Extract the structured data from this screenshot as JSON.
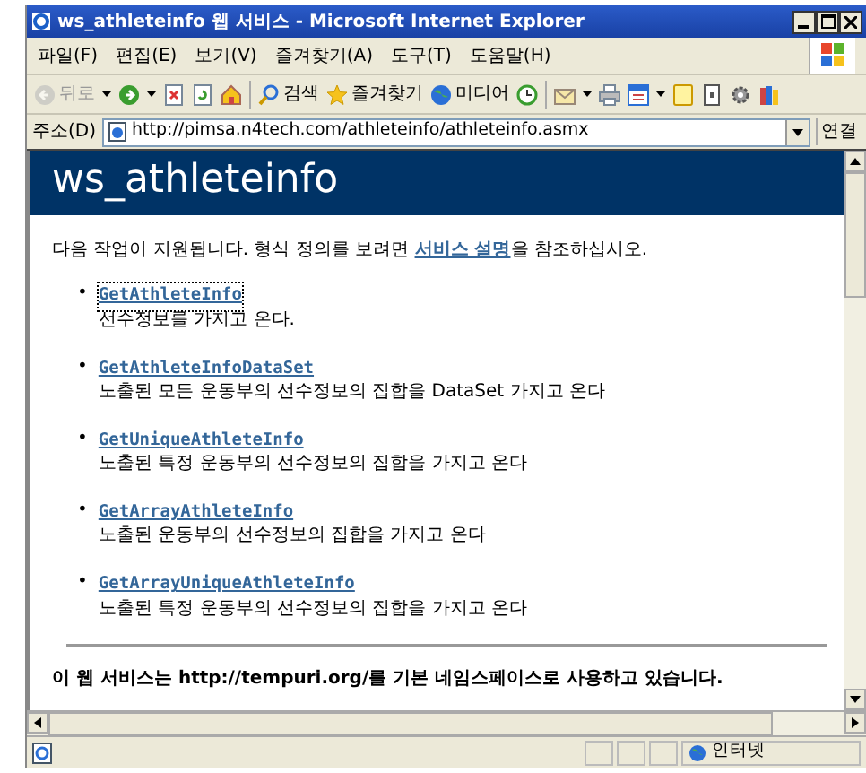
{
  "window": {
    "title": "ws_athleteinfo 웹 서비스 - Microsoft Internet Explorer"
  },
  "menu": [
    "파일(F)",
    "편집(E)",
    "보기(V)",
    "즐겨찾기(A)",
    "도구(T)",
    "도움말(H)"
  ],
  "toolbar": [
    {
      "kind": "back",
      "label": "뒤로",
      "disabled": true
    },
    {
      "kind": "forward"
    },
    {
      "kind": "stop"
    },
    {
      "kind": "refresh"
    },
    {
      "kind": "home"
    },
    {
      "kind": "search",
      "label": "검색"
    },
    {
      "kind": "favorites",
      "label": "즐겨찾기"
    },
    {
      "kind": "media",
      "label": "미디어"
    },
    {
      "kind": "history"
    },
    {
      "kind": "mail"
    },
    {
      "kind": "print"
    },
    {
      "kind": "edit"
    },
    {
      "kind": "note"
    },
    {
      "kind": "messenger"
    },
    {
      "kind": "tool"
    },
    {
      "kind": "research"
    }
  ],
  "address": {
    "label": "주소(D)",
    "url": "http://pimsa.n4tech.com/athleteinfo/athleteinfo.asmx",
    "go": "연결"
  },
  "page": {
    "heading": "ws_athleteinfo",
    "intro": {
      "before": "다음 작업이 지원됩니다. 형식 정의를 보려면 ",
      "link": "서비스 설명",
      "after": "을 참조하십시오."
    },
    "operations": [
      {
        "marker": "•",
        "name": "GetAthleteInfo",
        "description": "선수정보를 가지고 온다.",
        "focused": true
      },
      {
        "marker": "•",
        "name": "GetAthleteInfoDataSet",
        "description": "노출된 모든 운동부의 선수정보의 집합을 DataSet 가지고 온다",
        "focused": false
      },
      {
        "marker": "•",
        "name": "GetUniqueAthleteInfo",
        "description": "노출된 특정 운동부의 선수정보의 집합을 가지고 온다",
        "focused": false
      },
      {
        "marker": "•",
        "name": "GetArrayAthleteInfo",
        "description": "노출된 운동부의 선수정보의 집합을 가지고 온다",
        "focused": false
      },
      {
        "marker": "•",
        "name": "GetArrayUniqueAthleteInfo",
        "description": "노출된 특정 운동부의 선수정보의 집합을 가지고 온다",
        "focused": false
      }
    ],
    "footer": "이 웹 서비스는 http://tempuri.org/를 기본 네임스페이스로 사용하고 있습니다."
  },
  "status_bar": {
    "zone": "인터넷"
  }
}
